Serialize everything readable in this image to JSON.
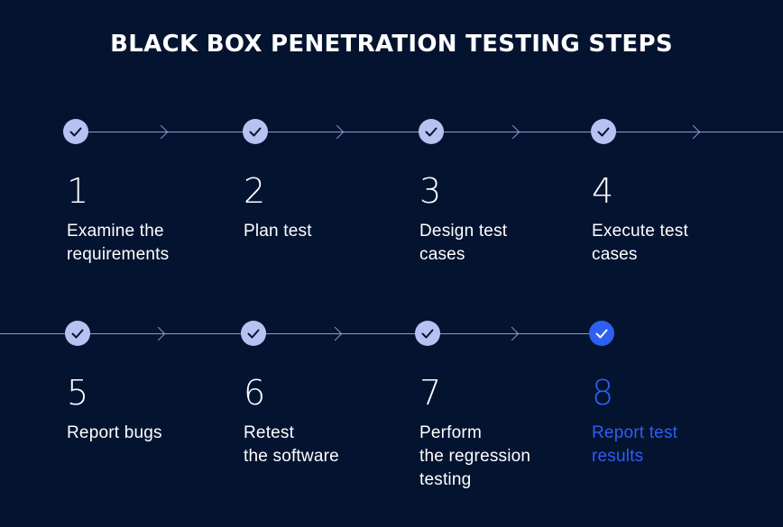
{
  "title": "BLACK BOX PENETRATION TESTING STEPS",
  "colors": {
    "background": "#041430",
    "accent": "#2f5ef2",
    "check": "#b7c1f2",
    "line": "#8b9bd6"
  },
  "steps": [
    {
      "number": "1",
      "label": "Examine the\nrequirements"
    },
    {
      "number": "2",
      "label": "Plan test"
    },
    {
      "number": "3",
      "label": "Design test\ncases"
    },
    {
      "number": "4",
      "label": "Execute test\ncases"
    },
    {
      "number": "5",
      "label": "Report bugs"
    },
    {
      "number": "6",
      "label": "Retest\nthe software"
    },
    {
      "number": "7",
      "label": "Perform\nthe regression\ntesting"
    },
    {
      "number": "8",
      "label": "Report test\nresults"
    }
  ]
}
